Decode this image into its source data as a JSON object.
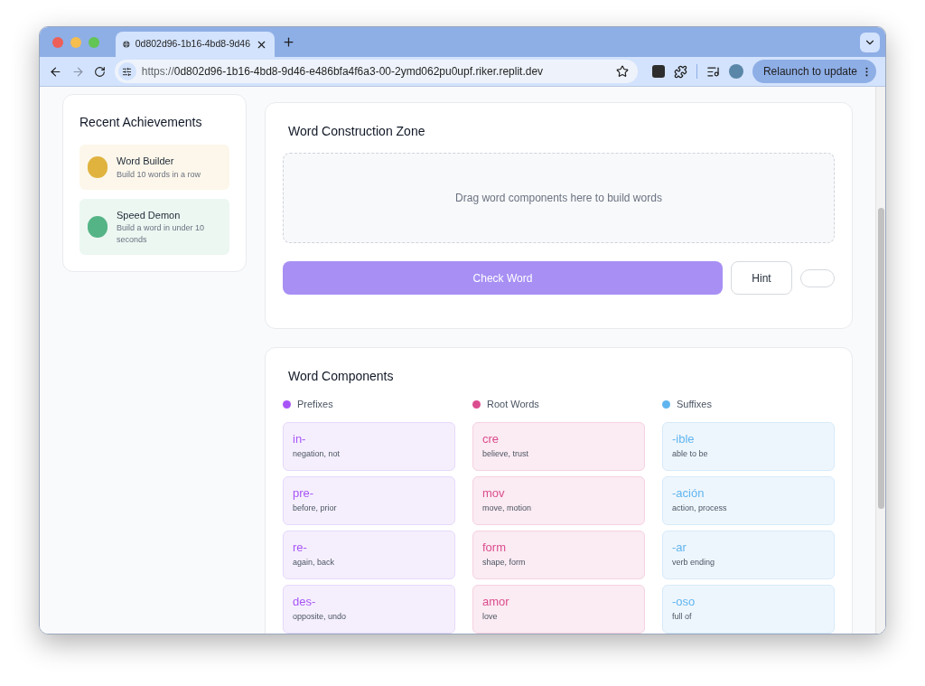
{
  "browser": {
    "tab_title": "0d802d96-1b16-4bd8-9d46",
    "url_scheme": "https://",
    "url_rest": "0d802d96-1b16-4bd8-9d46-e486bfa4f6a3-00-2ymd062pu0upf.riker.replit.dev",
    "relaunch_label": "Relaunch to update"
  },
  "achievements": {
    "title": "Recent Achievements",
    "items": [
      {
        "name": "Word Builder",
        "description": "Build 10 words in a row",
        "color": "#e0b33f"
      },
      {
        "name": "Speed Demon",
        "description": "Build a word in under 10 seconds",
        "color": "#55b486"
      }
    ]
  },
  "construction": {
    "title": "Word Construction Zone",
    "drop_hint": "Drag word components here to build words",
    "check_button": "Check Word",
    "hint_button": "Hint"
  },
  "components": {
    "title": "Word Components",
    "columns": [
      {
        "kind": "prefix",
        "label": "Prefixes",
        "color": "#a855f7",
        "items": [
          {
            "text": "in-",
            "meaning": "negation, not"
          },
          {
            "text": "pre-",
            "meaning": "before, prior"
          },
          {
            "text": "re-",
            "meaning": "again, back"
          },
          {
            "text": "des-",
            "meaning": "opposite, undo"
          }
        ]
      },
      {
        "kind": "root",
        "label": "Root Words",
        "color": "#db4d8f",
        "items": [
          {
            "text": "cre",
            "meaning": "believe, trust"
          },
          {
            "text": "mov",
            "meaning": "move, motion"
          },
          {
            "text": "form",
            "meaning": "shape, form"
          },
          {
            "text": "amor",
            "meaning": "love"
          }
        ]
      },
      {
        "kind": "suffix",
        "label": "Suffixes",
        "color": "#60b5ef",
        "items": [
          {
            "text": "-ible",
            "meaning": "able to be"
          },
          {
            "text": "-ación",
            "meaning": "action, process"
          },
          {
            "text": "-ar",
            "meaning": "verb ending"
          },
          {
            "text": "-oso",
            "meaning": "full of"
          }
        ]
      }
    ]
  }
}
